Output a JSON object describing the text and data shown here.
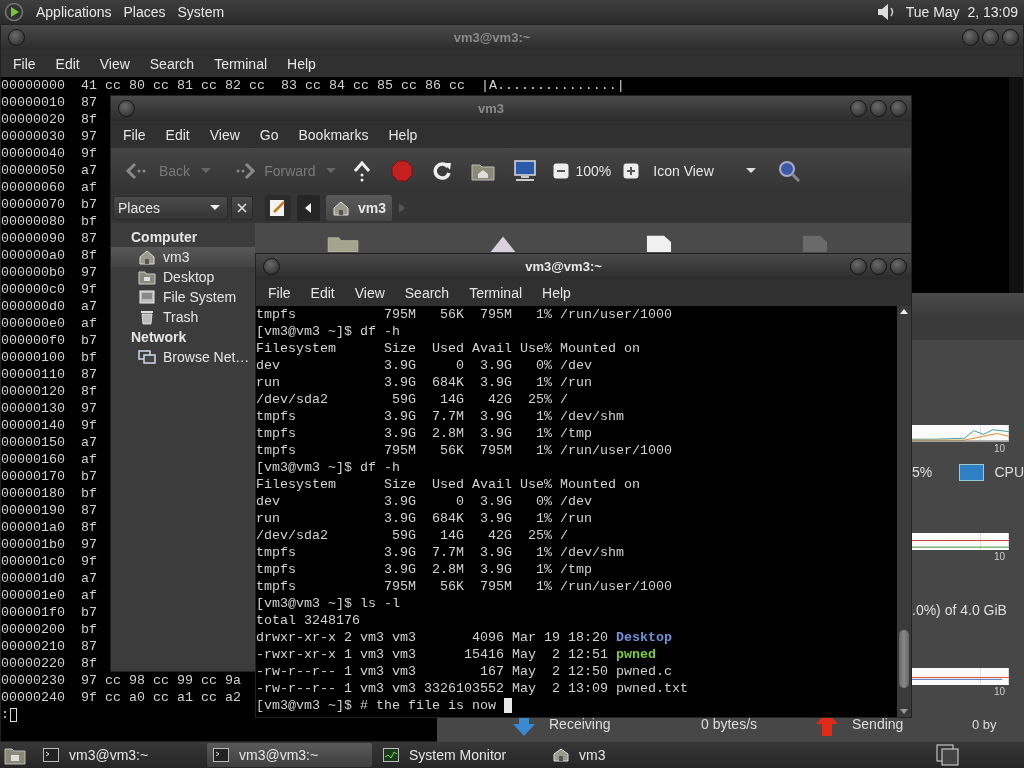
{
  "top_panel": {
    "menus": [
      "Applications",
      "Places",
      "System"
    ],
    "clock": "Tue May  2, 13:09"
  },
  "hex_terminal": {
    "title": "vm3@vm3:~",
    "menus": [
      "File",
      "Edit",
      "View",
      "Search",
      "Terminal",
      "Help"
    ],
    "lines": [
      "00000000  41 cc 80 cc 81 cc 82 cc  83 cc 84 cc 85 cc 86 cc  |A...............|",
      "00000010  87",
      "00000020  8f",
      "00000030  97",
      "00000040  9f",
      "00000050  a7",
      "00000060  af",
      "00000070  b7",
      "00000080  bf",
      "00000090  87",
      "000000a0  8f",
      "000000b0  97",
      "000000c0  9f",
      "000000d0  a7",
      "000000e0  af",
      "000000f0  b7",
      "00000100  bf",
      "00000110  87",
      "00000120  8f",
      "00000130  97",
      "00000140  9f",
      "00000150  a7",
      "00000160  af",
      "00000170  b7",
      "00000180  bf",
      "00000190  87",
      "000001a0  8f",
      "000001b0  97",
      "000001c0  9f",
      "000001d0  a7",
      "000001e0  af",
      "000001f0  b7",
      "00000200  bf",
      "00000210  87",
      "00000220  8f",
      "00000230  97 cc 98 cc 99 cc 9a",
      "00000240  9f cc a0 cc a1 cc a2"
    ],
    "prompt": ":"
  },
  "system_monitor": {
    "cpu_tick": "10",
    "cpu_percent": "5%",
    "cpu_legend": {
      "label": "CPU",
      "color": "#2f7fc4"
    },
    "memory_tick": "10",
    "memory_text": ".0%) of 4.0 GiB",
    "network_tick": "10",
    "receiving": {
      "label": "Receiving",
      "rate": "0 bytes/s"
    },
    "sending": {
      "label": "Sending",
      "rate": "0 by"
    }
  },
  "file_manager": {
    "title": "vm3",
    "menus": [
      "File",
      "Edit",
      "View",
      "Go",
      "Bookmarks",
      "Help"
    ],
    "nav_buttons": [
      {
        "label": "Back",
        "disabled": true
      },
      {
        "label": "Forward",
        "disabled": true
      }
    ],
    "zoom": "100%",
    "view_mode": "Icon View",
    "sidebar": {
      "header": "Places",
      "sections": [
        {
          "heading": "Computer",
          "items": [
            {
              "label": "vm3",
              "kind": "home",
              "selected": true
            },
            {
              "label": "Desktop",
              "kind": "desktop",
              "selected": false
            },
            {
              "label": "File System",
              "kind": "drive",
              "selected": false
            },
            {
              "label": "Trash",
              "kind": "trash",
              "selected": false
            }
          ]
        },
        {
          "heading": "Network",
          "items": [
            {
              "label": "Browse Net…",
              "kind": "network",
              "selected": false
            }
          ]
        }
      ]
    },
    "path": [
      {
        "label": "vm3",
        "selected": true
      }
    ]
  },
  "terminal": {
    "title": "vm3@vm3:~",
    "menus": [
      "File",
      "Edit",
      "View",
      "Search",
      "Terminal",
      "Help"
    ],
    "lines": [
      {
        "text": "tmpfs           795M   56K  795M   1% /run/user/1000"
      },
      {
        "text": "[vm3@vm3 ~]$ df -h"
      },
      {
        "text": "Filesystem      Size  Used Avail Use% Mounted on"
      },
      {
        "text": "dev             3.9G     0  3.9G   0% /dev"
      },
      {
        "text": "run             3.9G  684K  3.9G   1% /run"
      },
      {
        "text": "/dev/sda2        59G   14G   42G  25% /"
      },
      {
        "text": "tmpfs           3.9G  7.7M  3.9G   1% /dev/shm"
      },
      {
        "text": "tmpfs           3.9G  2.8M  3.9G   1% /tmp"
      },
      {
        "text": "tmpfs           795M   56K  795M   1% /run/user/1000"
      },
      {
        "text": "[vm3@vm3 ~]$ df -h"
      },
      {
        "text": "Filesystem      Size  Used Avail Use% Mounted on"
      },
      {
        "text": "dev             3.9G     0  3.9G   0% /dev"
      },
      {
        "text": "run             3.9G  684K  3.9G   1% /run"
      },
      {
        "text": "/dev/sda2        59G   14G   42G  25% /"
      },
      {
        "text": "tmpfs           3.9G  7.7M  3.9G   1% /dev/shm"
      },
      {
        "text": "tmpfs           3.9G  2.8M  3.9G   1% /tmp"
      },
      {
        "text": "tmpfs           795M   56K  795M   1% /run/user/1000"
      },
      {
        "text": "[vm3@vm3 ~]$ ls -l"
      },
      {
        "text": "total 3248176"
      },
      {
        "text": "drwxr-xr-x 2 vm3 vm3       4096 Mar 19 18:20 ",
        "file": "Desktop",
        "color": "#7190d8"
      },
      {
        "text": "-rwxr-xr-x 1 vm3 vm3      15416 May  2 12:51 ",
        "file": "pwned",
        "color": "#7ccf3a"
      },
      {
        "text": "-rw-r--r-- 1 vm3 vm3        167 May  2 12:50 pwned.c"
      },
      {
        "text": "-rw-r--r-- 1 vm3 vm3 3326103552 May  2 13:09 pwned.txt"
      },
      {
        "text": "[vm3@vm3 ~]$ # the file is now "
      }
    ]
  },
  "taskbar": {
    "tasks": [
      {
        "label": "vm3@vm3:~",
        "kind": "terminal",
        "selected": false
      },
      {
        "label": "vm3@vm3:~",
        "kind": "terminal",
        "selected": true
      },
      {
        "label": "System Monitor",
        "kind": "monitor",
        "selected": false
      },
      {
        "label": "vm3",
        "kind": "files",
        "selected": false
      }
    ]
  }
}
